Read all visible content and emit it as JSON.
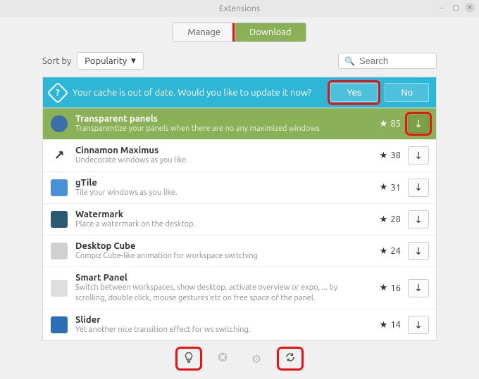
{
  "window": {
    "title": "Extensions"
  },
  "tabs": {
    "manage": "Manage",
    "download": "Download",
    "active": "download"
  },
  "sort": {
    "label": "Sort by",
    "value": "Popularity"
  },
  "search": {
    "placeholder": "Search"
  },
  "notice": {
    "text": "Your cache is out of date. Would you like to update it now?",
    "yes": "Yes",
    "no": "No"
  },
  "extensions": [
    {
      "name": "Transparent panels",
      "desc": "Transparentize your panels when there are no any maximized windows",
      "stars": 85,
      "selected": true,
      "iconColor": "#3a6fa8"
    },
    {
      "name": "Cinnamon Maximus",
      "desc": "Undecorate windows as you like.",
      "stars": 38,
      "selected": false,
      "iconGlyph": "↗"
    },
    {
      "name": "gTile",
      "desc": "Tile your windows as you like.",
      "stars": 31,
      "selected": false,
      "iconColor": "#4a90d9"
    },
    {
      "name": "Watermark",
      "desc": "Place a watermark on the desktop.",
      "stars": 28,
      "selected": false,
      "iconColor": "#2b5b73"
    },
    {
      "name": "Desktop Cube",
      "desc": "Compiz Cube-like animation for workspace switching",
      "stars": 24,
      "selected": false,
      "iconColor": "#d0d0d0"
    },
    {
      "name": "Smart Panel",
      "desc": "Switch between workspaces, show desktop, activate overview or expo, ... by scrolling, double click, mouse gestures etc on free space of the panel.",
      "stars": 16,
      "selected": false,
      "iconColor": "#dedede"
    },
    {
      "name": "Slider",
      "desc": "Yet another nice transition effect for ws switching.",
      "stars": 14,
      "selected": false,
      "iconColor": "#2d6fb5"
    }
  ],
  "bottombar": {
    "hint": "hint",
    "remove": "remove",
    "settings": "settings",
    "refresh": "refresh"
  }
}
